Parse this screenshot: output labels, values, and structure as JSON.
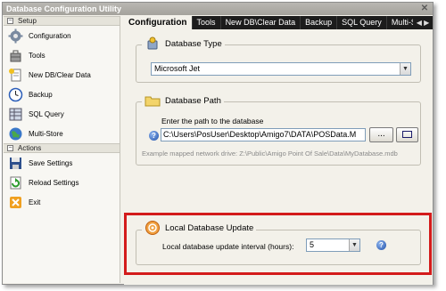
{
  "window": {
    "title": "Database Configuration Utility",
    "close_glyph": "✕"
  },
  "nav": {
    "setup_header": "Setup",
    "setup_items": [
      {
        "label": "Configuration",
        "icon": "gear-icon"
      },
      {
        "label": "Tools",
        "icon": "tools-icon"
      },
      {
        "label": "New DB/Clear Data",
        "icon": "new-document-icon"
      },
      {
        "label": "Backup",
        "icon": "clock-icon"
      },
      {
        "label": "SQL Query",
        "icon": "sql-grid-icon"
      },
      {
        "label": "Multi-Store",
        "icon": "globe-icon"
      }
    ],
    "actions_header": "Actions",
    "action_items": [
      {
        "label": "Save Settings",
        "icon": "floppy-disk-icon"
      },
      {
        "label": "Reload Settings",
        "icon": "reload-icon"
      },
      {
        "label": "Exit",
        "icon": "exit-icon"
      }
    ],
    "collapse_glyph": "−"
  },
  "tabs": [
    "Configuration",
    "Tools",
    "New DB\\Clear Data",
    "Backup",
    "SQL Query",
    "Multi-S"
  ],
  "tab_scroll": "◀ ▶",
  "database_type": {
    "title": "Database Type",
    "selected": "Microsoft Jet",
    "dropdown_glyph": "▼"
  },
  "database_path": {
    "title": "Database Path",
    "prompt": "Enter the path to the database",
    "value": "C:\\Users\\PosUser\\Desktop\\Amigo7\\DATA\\POSData.M",
    "browse_label": "...",
    "help_glyph": "?",
    "hint": "Example mapped network drive:  Z:\\Public\\Amigo Point Of Sale\\Data\\MyDatabase.mdb"
  },
  "local_update": {
    "title": "Local Database Update",
    "interval_label": "Local database update interval (hours):",
    "interval_value": "5",
    "help_glyph": "?"
  },
  "colors": {
    "highlight": "#d31b1b",
    "tab_bar": "#1c1c1c",
    "panel": "#f3f1ea"
  }
}
